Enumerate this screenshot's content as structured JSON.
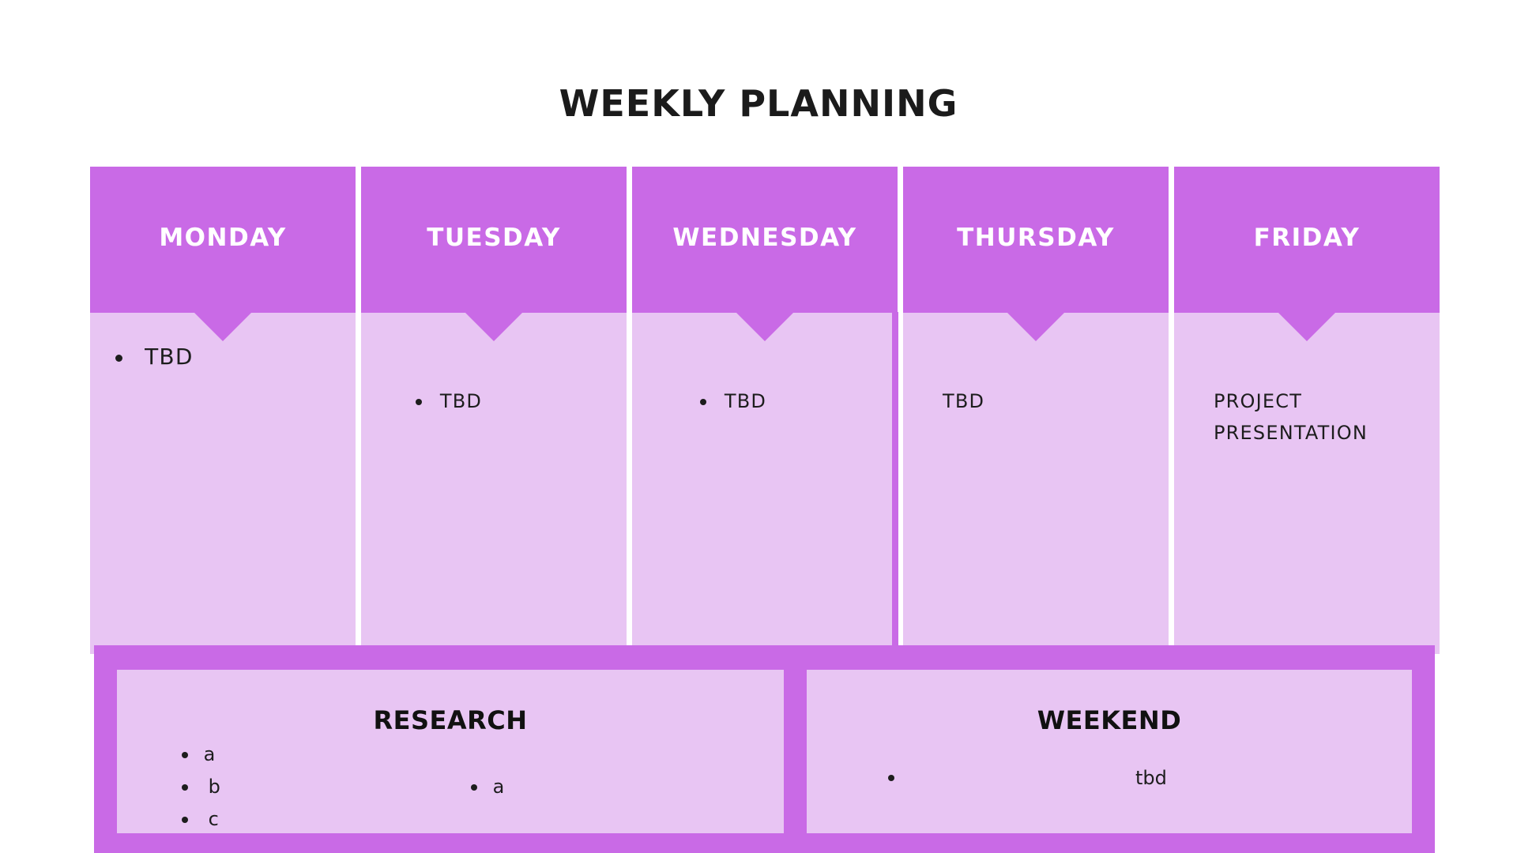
{
  "title": "WEEKLY PLANNING",
  "colors": {
    "accent": "#c96ae6",
    "panel": "#e8c5f3",
    "background": "#ffffff",
    "text": "#1a1a1a"
  },
  "days": [
    {
      "name": "MONDAY",
      "items": [
        "TBD"
      ]
    },
    {
      "name": "TUESDAY",
      "items": [
        "TBD"
      ]
    },
    {
      "name": "WEDNESDAY",
      "items": [
        "TBD"
      ]
    },
    {
      "name": "THURSDAY",
      "text": "TBD"
    },
    {
      "name": "FRIDAY",
      "lines": [
        "PROJECT",
        "PRESENTATION"
      ]
    }
  ],
  "research": {
    "title": "RESEARCH",
    "list_left": [
      "a",
      "b",
      "c"
    ],
    "list_right": [
      "a"
    ]
  },
  "weekend": {
    "title": "WEEKEND",
    "items": [
      "tbd"
    ]
  }
}
